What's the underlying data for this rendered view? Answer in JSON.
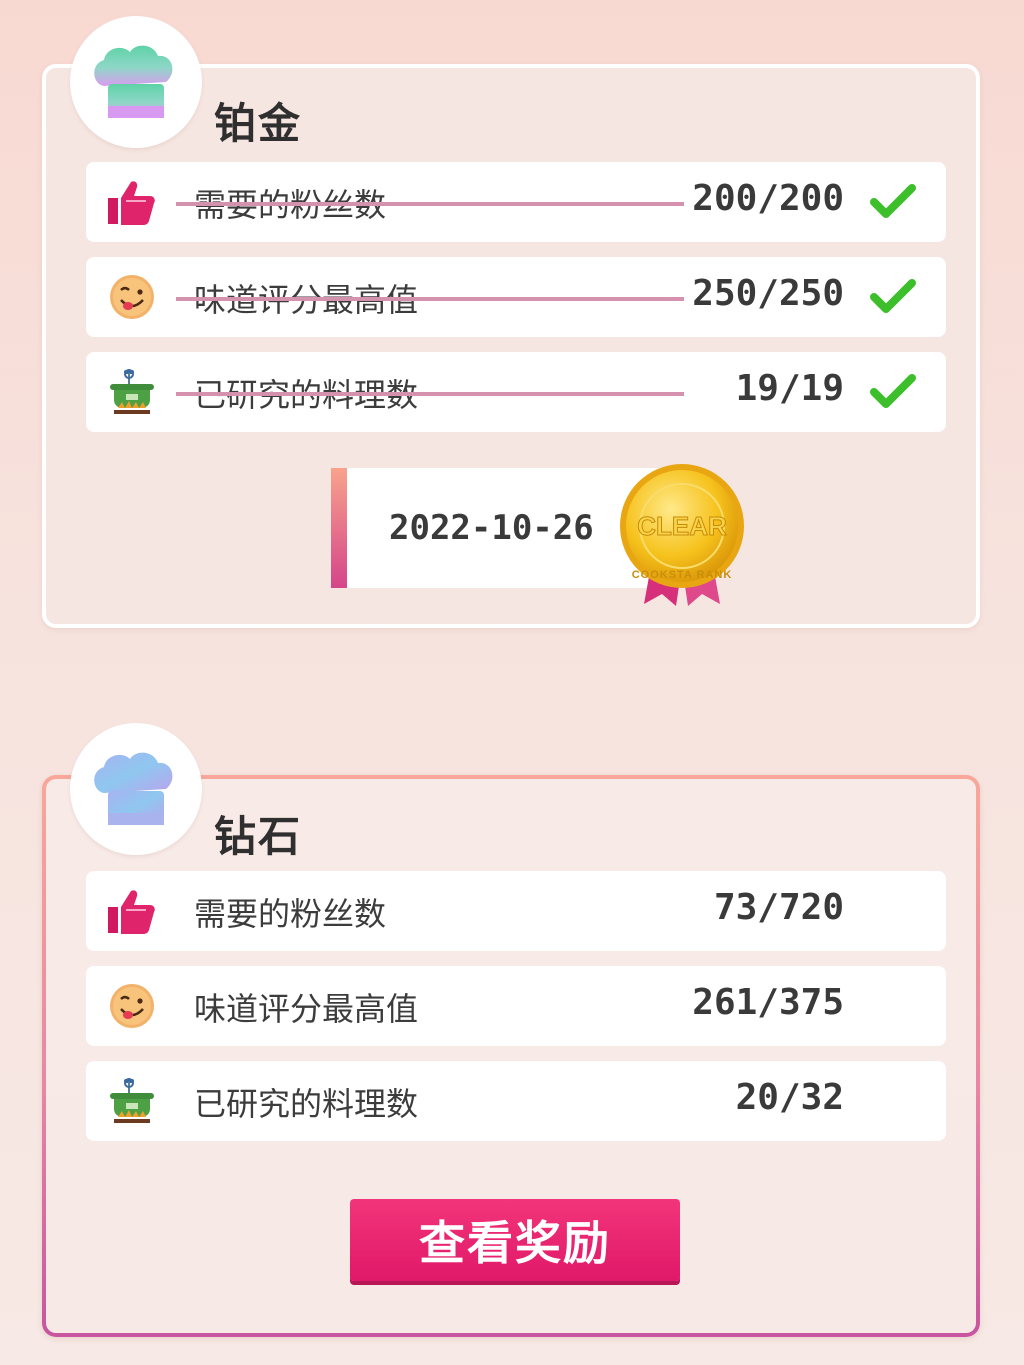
{
  "platinum": {
    "title": "铂金",
    "rows": [
      {
        "label": "需要的粉丝数",
        "value": "200/200",
        "icon": "thumbs-up-icon",
        "completed": true
      },
      {
        "label": "味道评分最高值",
        "value": "250/250",
        "icon": "smiley-face-icon",
        "completed": true
      },
      {
        "label": "已研究的料理数",
        "value": "19/19",
        "icon": "cooking-pot-icon",
        "completed": true
      }
    ],
    "clear_date": "2022-10-26",
    "medal_text": "CLEAR",
    "medal_ring_text": "COOKSTA RANK"
  },
  "diamond": {
    "title": "钻石",
    "rows": [
      {
        "label": "需要的粉丝数",
        "value": "73/720",
        "icon": "thumbs-up-icon",
        "completed": false
      },
      {
        "label": "味道评分最高值",
        "value": "261/375",
        "icon": "smiley-face-icon",
        "completed": false
      },
      {
        "label": "已研究的料理数",
        "value": "20/32",
        "icon": "cooking-pot-icon",
        "completed": false
      }
    ],
    "reward_button": "查看奖励"
  },
  "colors": {
    "accent_pink": "#e01868",
    "check_green": "#3cbf2a",
    "strike_pink": "#d592ae"
  }
}
